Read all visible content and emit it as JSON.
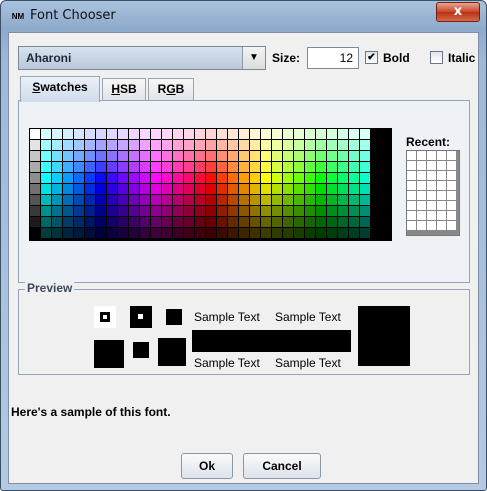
{
  "window": {
    "title": "Font Chooser",
    "logo": "NM",
    "close_label": "x"
  },
  "font": {
    "selected": "Aharoni",
    "dropdown_icon": "triangle-down-icon"
  },
  "size": {
    "label": "Size:",
    "value": "12"
  },
  "bold": {
    "label": "Bold",
    "checked": true
  },
  "italic": {
    "label": "Italic",
    "checked": false
  },
  "tabs": [
    {
      "prefix": "",
      "mnemonic": "S",
      "rest": "watches",
      "active": true
    },
    {
      "prefix": "",
      "mnemonic": "H",
      "rest": "SB",
      "active": false
    },
    {
      "prefix": "R",
      "mnemonic": "G",
      "rest": "B",
      "active": false
    }
  ],
  "swatches": {
    "recent_label": "Recent:"
  },
  "preview": {
    "title": "Preview",
    "sample_text": "Sample Text"
  },
  "sample_sentence": "Here's a sample of this font.",
  "buttons": {
    "ok": "Ok",
    "cancel": "Cancel"
  }
}
